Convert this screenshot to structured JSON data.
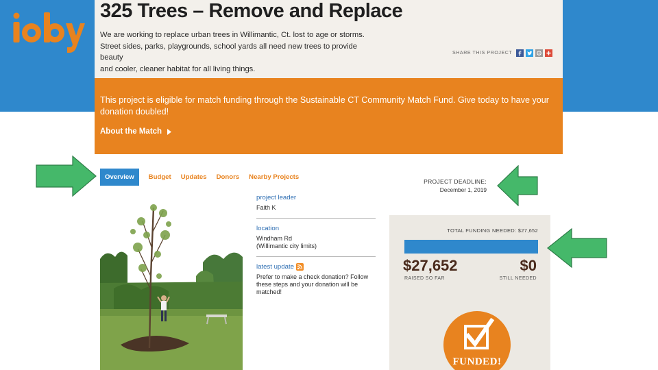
{
  "logo": {
    "text": "ioby",
    "color": "#e8831f"
  },
  "project": {
    "title": "325 Trees – Remove and Replace",
    "description_lines": [
      "We are working to replace urban trees in Willimantic, Ct. lost to age or storms.",
      "Street sides, parks, playgrounds, school yards all need new trees to provide beauty",
      "and cooler, cleaner habitat for all living things."
    ]
  },
  "share": {
    "label": "SHARE THIS PROJECT",
    "icons": [
      "facebook-icon",
      "twitter-icon",
      "email-icon",
      "googleplus-icon"
    ]
  },
  "match": {
    "text": "This project is eligible for match funding through the Sustainable CT Community Match Fund. Give today to have your donation doubled!",
    "about_label": "About the Match"
  },
  "tabs": [
    {
      "label": "Overview",
      "active": true
    },
    {
      "label": "Budget",
      "active": false
    },
    {
      "label": "Updates",
      "active": false
    },
    {
      "label": "Donors",
      "active": false
    },
    {
      "label": "Nearby Projects",
      "active": false
    }
  ],
  "deadline": {
    "label": "PROJECT DEADLINE:",
    "date": "December 1, 2019"
  },
  "info": {
    "leader_label": "project leader",
    "leader_value": "Faith K",
    "location_label": "location",
    "location_line1": "Windham Rd",
    "location_line2": "(Willimantic city limits)",
    "update_label": "latest update",
    "update_text": "Prefer to make a check donation? Follow these steps and your donation will be matched!"
  },
  "funding": {
    "needed_label": "TOTAL FUNDING NEEDED:",
    "needed_value": "$27,652",
    "progress_fraction": 1.0,
    "raised": "$27,652",
    "raised_label": "RAISED SO FAR",
    "still_needed": "$0",
    "still_needed_label": "STILL NEEDED",
    "badge_text": "FUNDED!"
  },
  "colors": {
    "blue": "#2f88cc",
    "orange": "#e8831f",
    "arrow_green": "#45b86a",
    "header_bg": "#f3f0eb"
  }
}
